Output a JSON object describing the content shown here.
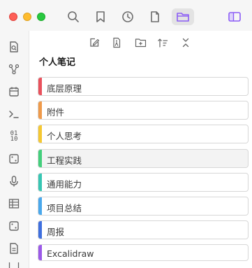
{
  "pane": {
    "title": "个人笔记"
  },
  "folders": [
    {
      "label": "底层原理",
      "color": "#e9515c"
    },
    {
      "label": "附件",
      "color": "#ef9a4a"
    },
    {
      "label": "个人思考",
      "color": "#f5c832"
    },
    {
      "label": "工程实践",
      "color": "#43cf7c"
    },
    {
      "label": "通用能力",
      "color": "#37c6b3"
    },
    {
      "label": "项目总结",
      "color": "#4aa8ec"
    },
    {
      "label": "周报",
      "color": "#3f6fde"
    },
    {
      "label": "Excalidraw",
      "color": "#9b59e8"
    }
  ],
  "ribbon": {
    "binary_icon_text": "01\n10"
  },
  "colors": {
    "accent": "#8b5cf6",
    "active_tab_bg": "#e3e3e3"
  }
}
